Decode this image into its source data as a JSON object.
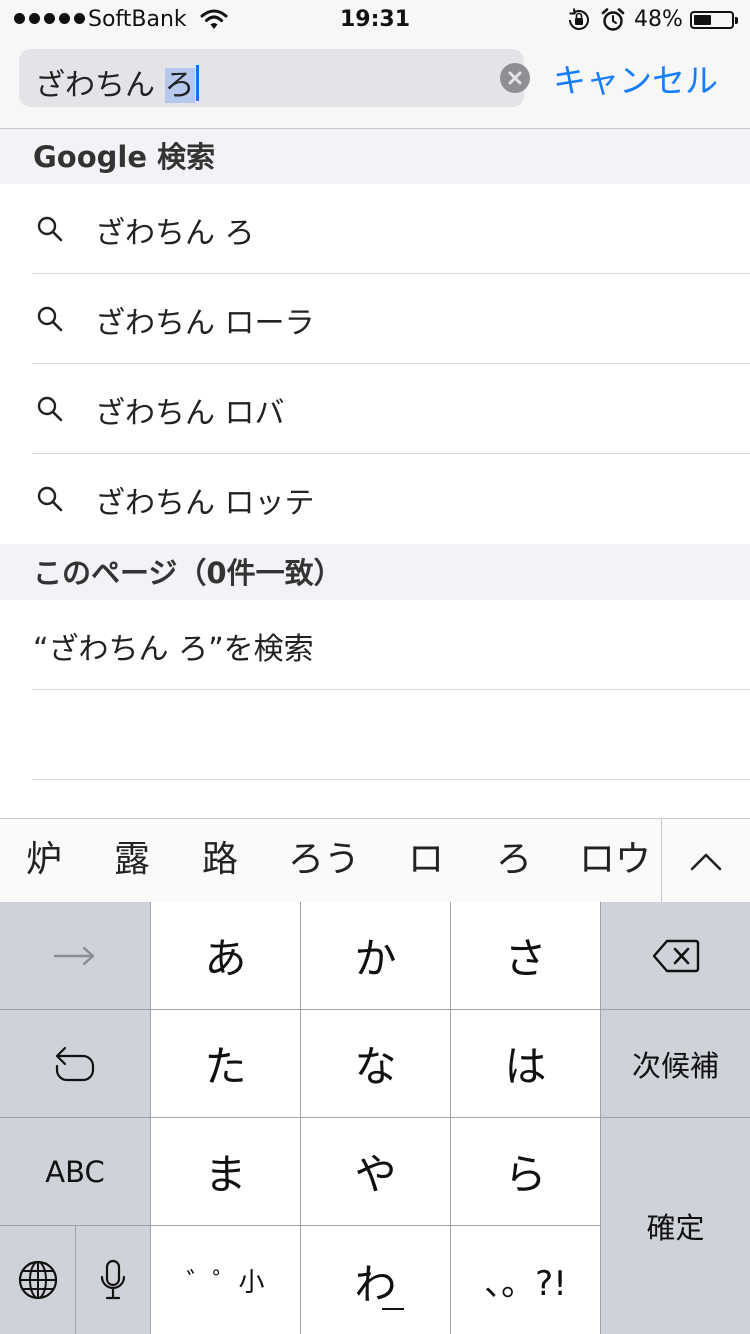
{
  "status_bar": {
    "carrier": "SoftBank",
    "time": "19:31",
    "battery_percent": "48%",
    "battery_level": 0.48
  },
  "search": {
    "query_prefix": "ざわちん ",
    "query_marked": "ろ",
    "cancel_label": "キャンセル"
  },
  "google_section": {
    "title": "Google 検索",
    "suggestions": [
      "ざわちん ろ",
      "ざわちん ローラ",
      "ざわちん ロバ",
      "ざわちん ロッテ"
    ]
  },
  "page_section": {
    "title": "このページ（0件一致）",
    "search_label": "“ざわちん ろ”を検索"
  },
  "candidates": [
    "炉",
    "露",
    "路",
    "ろう",
    "ロ",
    "ろ",
    "ロウ"
  ],
  "keyboard": {
    "row1": [
      "あ",
      "か",
      "さ"
    ],
    "row2": [
      "た",
      "な",
      "は"
    ],
    "row3": [
      "ま",
      "や",
      "ら"
    ],
    "dakuten_key": "゛゜小",
    "wa_key": "わ",
    "punct_key": "、。?!",
    "next_candidate": "次候補",
    "abc": "ABC",
    "confirm": "確定"
  },
  "icons": {
    "search": "search-icon",
    "clear": "clear-icon",
    "wifi": "wifi-icon",
    "rotation_lock": "rotation-lock-icon",
    "alarm": "alarm-icon",
    "expand": "chevron-up-icon",
    "arrow": "arrow-right-icon",
    "delete": "delete-icon",
    "undo": "undo-icon",
    "globe": "globe-icon",
    "mic": "microphone-icon"
  },
  "colors": {
    "accent": "#147efb",
    "marked_text": "#b6c8ee",
    "caret": "#1a6ff4"
  }
}
